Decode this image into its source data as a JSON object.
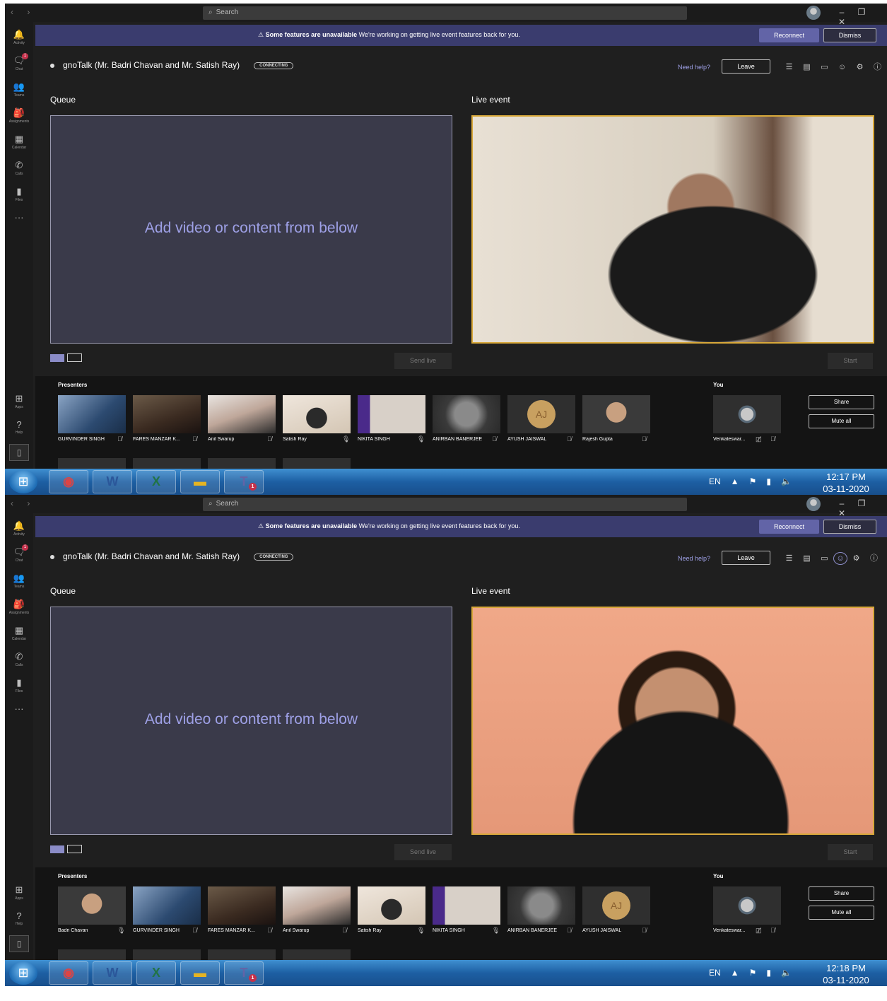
{
  "window": {
    "nav": "‹ ›",
    "search_placeholder": "Search",
    "controls": [
      "–",
      "❐",
      "✕"
    ]
  },
  "rail": [
    {
      "label": "Activity",
      "icon": "bell-icon",
      "glyph": "🔔"
    },
    {
      "label": "Chat",
      "icon": "chat-icon",
      "glyph": "🗨",
      "badge": "1"
    },
    {
      "label": "Teams",
      "icon": "teams-icon",
      "glyph": "👥"
    },
    {
      "label": "Assignments",
      "icon": "assignments-icon",
      "glyph": "🎒"
    },
    {
      "label": "Calendar",
      "icon": "calendar-icon",
      "glyph": "▦"
    },
    {
      "label": "Calls",
      "icon": "phone-icon",
      "glyph": "✆"
    },
    {
      "label": "Files",
      "icon": "files-icon",
      "glyph": "▮"
    },
    {
      "label": "",
      "icon": "more-icon",
      "glyph": "···"
    }
  ],
  "rail_bottom": [
    {
      "label": "Apps",
      "icon": "apps-icon",
      "glyph": "⊞"
    },
    {
      "label": "Help",
      "icon": "help-icon",
      "glyph": "?"
    }
  ],
  "banner": {
    "bold": "Some features are unavailable",
    "text": "We're working on getting live event features back for you.",
    "reconnect": "Reconnect",
    "dismiss": "Dismiss"
  },
  "meeting": {
    "title": "gnoTalk (Mr. Badri Chavan and Mr. Satish Ray)",
    "status": "CONNECTING",
    "need_help": "Need help?",
    "leave": "Leave"
  },
  "queue": {
    "label": "Queue",
    "placeholder": "Add video or content from below",
    "send_live": "Send live"
  },
  "live": {
    "label": "Live event",
    "start": "Start"
  },
  "presenters_label": "Presenters",
  "you_label": "You",
  "share": "Share",
  "mute_all": "Mute all",
  "colors": {
    "accent": "#6264a7",
    "banner": "#3a3c6e",
    "live_border": "#d8a83a",
    "queue_text": "#9ea0e6",
    "bg": "#1f1f1f"
  },
  "screens": [
    {
      "presenters": [
        {
          "name": "GURVINDER SINGH",
          "mic": "muted"
        },
        {
          "name": "FARES MANZAR K...",
          "mic": "muted"
        },
        {
          "name": "Anil Swarup",
          "mic": "muted"
        },
        {
          "name": "Satish Ray",
          "mic": "on"
        },
        {
          "name": "NIKITA SINGH",
          "mic": "on"
        },
        {
          "name": "ANIRBAN BANERJEE",
          "mic": "muted"
        },
        {
          "name": "AYUSH JAISWAL",
          "initials": "AJ",
          "mic": "muted"
        },
        {
          "name": "Rajesh Gupta",
          "mic": "muted"
        }
      ],
      "you": {
        "name": "Venkateswar..."
      },
      "clock": {
        "time": "12:17 PM",
        "date": "03-11-2020"
      }
    },
    {
      "presenters": [
        {
          "name": "Badri Chavan",
          "mic": "on"
        },
        {
          "name": "GURVINDER SINGH",
          "mic": "muted"
        },
        {
          "name": "FARES MANZAR K...",
          "mic": "muted"
        },
        {
          "name": "Anil Swarup",
          "mic": "muted"
        },
        {
          "name": "Satish Ray",
          "mic": "on"
        },
        {
          "name": "NIKITA SINGH",
          "mic": "on"
        },
        {
          "name": "ANIRBAN BANERJEE",
          "mic": "muted"
        },
        {
          "name": "AYUSH JAISWAL",
          "initials": "AJ",
          "mic": "muted"
        }
      ],
      "you": {
        "name": "Venkateswar..."
      },
      "clock": {
        "time": "12:18 PM",
        "date": "03-11-2020"
      }
    }
  ],
  "taskbar": {
    "lang": "EN",
    "apps": [
      "chrome-icon",
      "word-icon",
      "excel-icon",
      "explorer-icon",
      "teams-icon"
    ]
  }
}
